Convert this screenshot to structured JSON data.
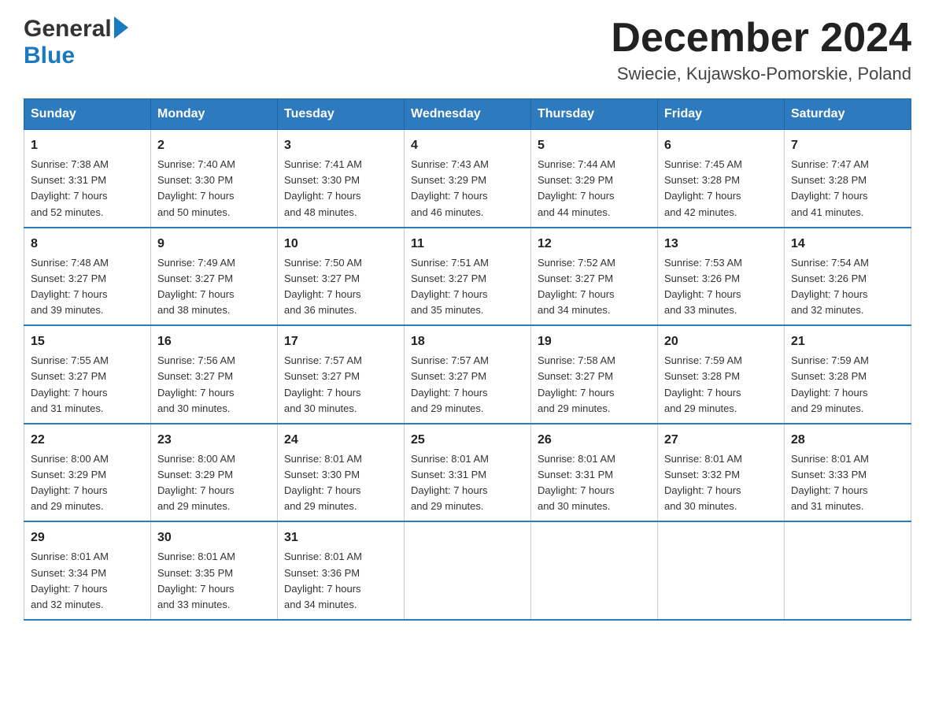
{
  "header": {
    "logo_general": "General",
    "logo_blue": "Blue",
    "month_title": "December 2024",
    "location": "Swiecie, Kujawsko-Pomorskie, Poland"
  },
  "days_of_week": [
    "Sunday",
    "Monday",
    "Tuesday",
    "Wednesday",
    "Thursday",
    "Friday",
    "Saturday"
  ],
  "weeks": [
    [
      {
        "day": "1",
        "sunrise": "7:38 AM",
        "sunset": "3:31 PM",
        "daylight": "7 hours and 52 minutes."
      },
      {
        "day": "2",
        "sunrise": "7:40 AM",
        "sunset": "3:30 PM",
        "daylight": "7 hours and 50 minutes."
      },
      {
        "day": "3",
        "sunrise": "7:41 AM",
        "sunset": "3:30 PM",
        "daylight": "7 hours and 48 minutes."
      },
      {
        "day": "4",
        "sunrise": "7:43 AM",
        "sunset": "3:29 PM",
        "daylight": "7 hours and 46 minutes."
      },
      {
        "day": "5",
        "sunrise": "7:44 AM",
        "sunset": "3:29 PM",
        "daylight": "7 hours and 44 minutes."
      },
      {
        "day": "6",
        "sunrise": "7:45 AM",
        "sunset": "3:28 PM",
        "daylight": "7 hours and 42 minutes."
      },
      {
        "day": "7",
        "sunrise": "7:47 AM",
        "sunset": "3:28 PM",
        "daylight": "7 hours and 41 minutes."
      }
    ],
    [
      {
        "day": "8",
        "sunrise": "7:48 AM",
        "sunset": "3:27 PM",
        "daylight": "7 hours and 39 minutes."
      },
      {
        "day": "9",
        "sunrise": "7:49 AM",
        "sunset": "3:27 PM",
        "daylight": "7 hours and 38 minutes."
      },
      {
        "day": "10",
        "sunrise": "7:50 AM",
        "sunset": "3:27 PM",
        "daylight": "7 hours and 36 minutes."
      },
      {
        "day": "11",
        "sunrise": "7:51 AM",
        "sunset": "3:27 PM",
        "daylight": "7 hours and 35 minutes."
      },
      {
        "day": "12",
        "sunrise": "7:52 AM",
        "sunset": "3:27 PM",
        "daylight": "7 hours and 34 minutes."
      },
      {
        "day": "13",
        "sunrise": "7:53 AM",
        "sunset": "3:26 PM",
        "daylight": "7 hours and 33 minutes."
      },
      {
        "day": "14",
        "sunrise": "7:54 AM",
        "sunset": "3:26 PM",
        "daylight": "7 hours and 32 minutes."
      }
    ],
    [
      {
        "day": "15",
        "sunrise": "7:55 AM",
        "sunset": "3:27 PM",
        "daylight": "7 hours and 31 minutes."
      },
      {
        "day": "16",
        "sunrise": "7:56 AM",
        "sunset": "3:27 PM",
        "daylight": "7 hours and 30 minutes."
      },
      {
        "day": "17",
        "sunrise": "7:57 AM",
        "sunset": "3:27 PM",
        "daylight": "7 hours and 30 minutes."
      },
      {
        "day": "18",
        "sunrise": "7:57 AM",
        "sunset": "3:27 PM",
        "daylight": "7 hours and 29 minutes."
      },
      {
        "day": "19",
        "sunrise": "7:58 AM",
        "sunset": "3:27 PM",
        "daylight": "7 hours and 29 minutes."
      },
      {
        "day": "20",
        "sunrise": "7:59 AM",
        "sunset": "3:28 PM",
        "daylight": "7 hours and 29 minutes."
      },
      {
        "day": "21",
        "sunrise": "7:59 AM",
        "sunset": "3:28 PM",
        "daylight": "7 hours and 29 minutes."
      }
    ],
    [
      {
        "day": "22",
        "sunrise": "8:00 AM",
        "sunset": "3:29 PM",
        "daylight": "7 hours and 29 minutes."
      },
      {
        "day": "23",
        "sunrise": "8:00 AM",
        "sunset": "3:29 PM",
        "daylight": "7 hours and 29 minutes."
      },
      {
        "day": "24",
        "sunrise": "8:01 AM",
        "sunset": "3:30 PM",
        "daylight": "7 hours and 29 minutes."
      },
      {
        "day": "25",
        "sunrise": "8:01 AM",
        "sunset": "3:31 PM",
        "daylight": "7 hours and 29 minutes."
      },
      {
        "day": "26",
        "sunrise": "8:01 AM",
        "sunset": "3:31 PM",
        "daylight": "7 hours and 30 minutes."
      },
      {
        "day": "27",
        "sunrise": "8:01 AM",
        "sunset": "3:32 PM",
        "daylight": "7 hours and 30 minutes."
      },
      {
        "day": "28",
        "sunrise": "8:01 AM",
        "sunset": "3:33 PM",
        "daylight": "7 hours and 31 minutes."
      }
    ],
    [
      {
        "day": "29",
        "sunrise": "8:01 AM",
        "sunset": "3:34 PM",
        "daylight": "7 hours and 32 minutes."
      },
      {
        "day": "30",
        "sunrise": "8:01 AM",
        "sunset": "3:35 PM",
        "daylight": "7 hours and 33 minutes."
      },
      {
        "day": "31",
        "sunrise": "8:01 AM",
        "sunset": "3:36 PM",
        "daylight": "7 hours and 34 minutes."
      },
      null,
      null,
      null,
      null
    ]
  ],
  "labels": {
    "sunrise": "Sunrise: ",
    "sunset": "Sunset: ",
    "daylight": "Daylight: "
  }
}
